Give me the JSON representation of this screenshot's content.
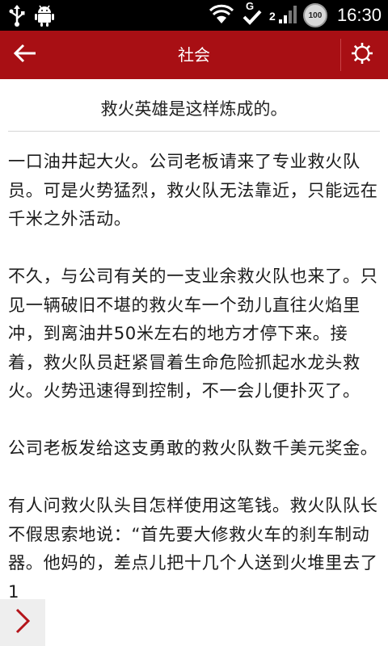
{
  "status_bar": {
    "time": "16:30",
    "battery_level": "100",
    "icons": [
      "usb-icon",
      "android-debug-icon",
      "wifi-icon",
      "check-icon",
      "signal-icon"
    ],
    "network_type": "G",
    "signal_label": "2"
  },
  "header": {
    "title": "社会",
    "back_icon": "back-arrow-icon",
    "settings_icon": "gear-icon",
    "accent_color": "#a80f14"
  },
  "article": {
    "title": "救火英雄是这样炼成的。",
    "paragraphs": [
      "一口油井起大火。公司老板请来了专业救火队员。可是火势猛烈，救火队无法靠近，只能远在千米之外活动。",
      "不久，与公司有关的一支业余救火队也来了。只见一辆破旧不堪的救火车一个劲儿直往火焰里冲，到离油井50米左右的地方才停下来。接着，救火队员赶紧冒着生命危险抓起水龙头救火。火势迅速得到控制，不一会儿便扑灭了。",
      "公司老板发给这支勇敢的救火队数千美元奖金。",
      "有人问救火队头目怎样使用这笔钱。救火队队长不假思索地说：“首先要大修救火车的刹车制动器。他妈的，差点儿把十几个人送到火堆里去了 1"
    ]
  },
  "next_button": {
    "icon": "chevron-right-icon"
  }
}
